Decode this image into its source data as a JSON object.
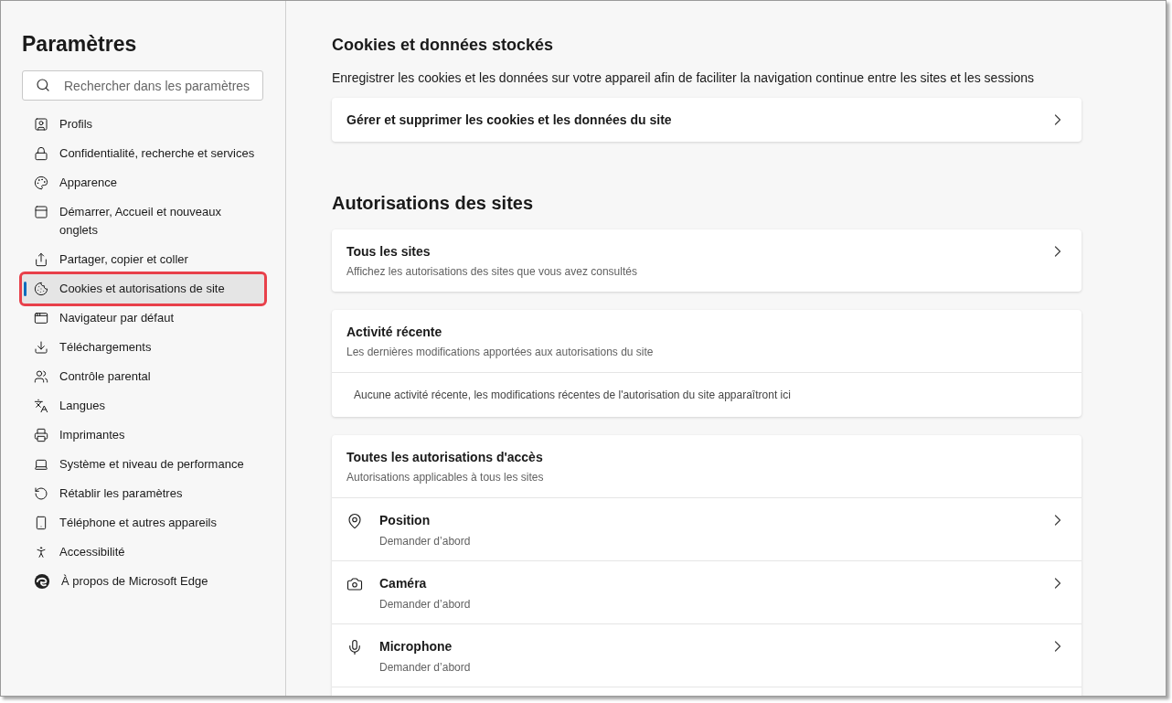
{
  "sidebar": {
    "title": "Paramètres",
    "search": {
      "placeholder": "Rechercher dans les paramètres"
    },
    "items": [
      {
        "label": "Profils",
        "selected": false,
        "highlighted": false
      },
      {
        "label": "Confidentialité, recherche et services",
        "selected": false,
        "highlighted": false
      },
      {
        "label": "Apparence",
        "selected": false,
        "highlighted": false
      },
      {
        "label": "Démarrer, Accueil et nouveaux onglets",
        "selected": false,
        "highlighted": false
      },
      {
        "label": "Partager, copier et coller",
        "selected": false,
        "highlighted": false
      },
      {
        "label": "Cookies et autorisations de site",
        "selected": true,
        "highlighted": true
      },
      {
        "label": "Navigateur par défaut",
        "selected": false,
        "highlighted": false
      },
      {
        "label": "Téléchargements",
        "selected": false,
        "highlighted": false
      },
      {
        "label": "Contrôle parental",
        "selected": false,
        "highlighted": false
      },
      {
        "label": "Langues",
        "selected": false,
        "highlighted": false
      },
      {
        "label": "Imprimantes",
        "selected": false,
        "highlighted": false
      },
      {
        "label": "Système et niveau de performance",
        "selected": false,
        "highlighted": false
      },
      {
        "label": "Rétablir les paramètres",
        "selected": false,
        "highlighted": false
      },
      {
        "label": "Téléphone et autres appareils",
        "selected": false,
        "highlighted": false
      },
      {
        "label": "Accessibilité",
        "selected": false,
        "highlighted": false
      },
      {
        "label": "À propos de Microsoft Edge",
        "selected": false,
        "highlighted": false
      }
    ]
  },
  "cookies": {
    "heading": "Cookies et données stockés",
    "description": "Enregistrer les cookies et les données sur votre appareil afin de faciliter la navigation continue entre les sites et les sessions",
    "link": "Gérer et supprimer les cookies et les données du site"
  },
  "permissions": {
    "heading": "Autorisations des sites",
    "all_sites": {
      "title": "Tous les sites",
      "subtitle": "Affichez les autorisations des sites que vous avez consultés"
    },
    "recent": {
      "title": "Activité récente",
      "subtitle": "Les dernières modifications apportées aux autorisations du site",
      "empty": "Aucune activité récente, les modifications récentes de l'autorisation du site apparaîtront ici"
    },
    "all_permissions": {
      "title": "Toutes les autorisations d'accès",
      "subtitle": "Autorisations applicables à tous les sites",
      "items": [
        {
          "title": "Position",
          "value": "Demander d’abord"
        },
        {
          "title": "Caméra",
          "value": "Demander d’abord"
        },
        {
          "title": "Microphone",
          "value": "Demander d’abord"
        }
      ]
    }
  }
}
